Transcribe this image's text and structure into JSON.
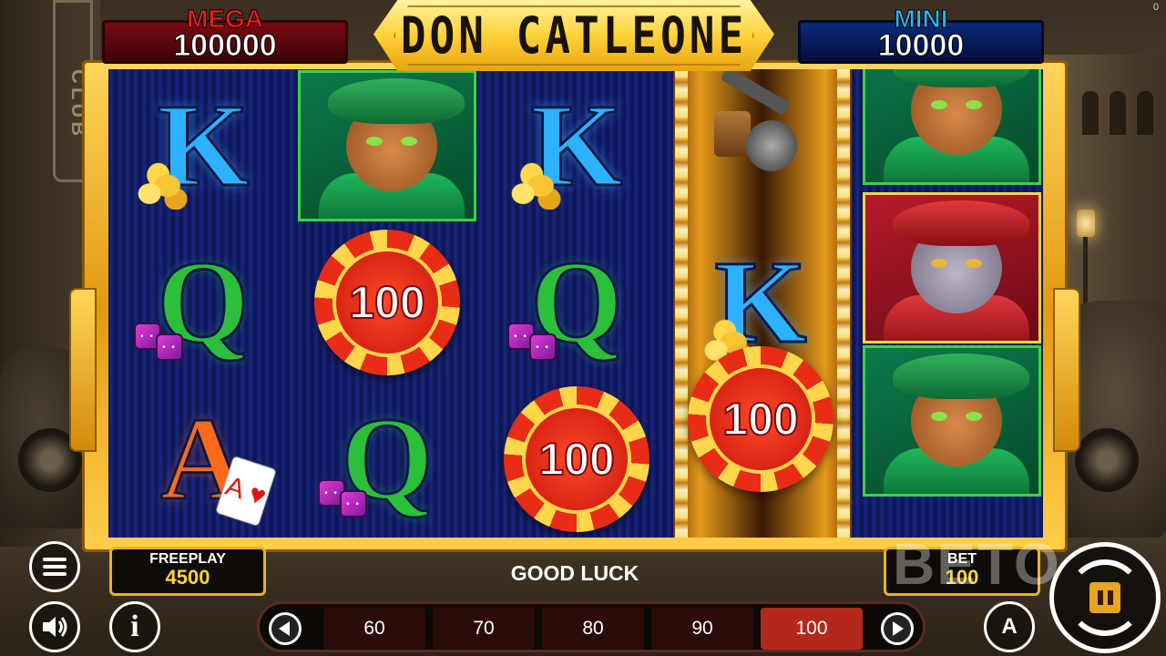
{
  "game": {
    "title": "DON CATLEONE",
    "corner_counter": "0"
  },
  "jackpots": {
    "mega": {
      "label": "MEGA",
      "value": "100000",
      "color": "#ff1a1a"
    },
    "mini": {
      "label": "MINI",
      "value": "10000",
      "color": "#2ab6ff"
    }
  },
  "background": {
    "sign_text": "CLUB"
  },
  "reels": {
    "symbols": [
      [
        {
          "kind": "letter",
          "text": "K",
          "extra": "coins"
        },
        {
          "kind": "letter",
          "text": "Q",
          "extra": "dice"
        },
        {
          "kind": "letter",
          "text": "A",
          "extra": "card"
        }
      ],
      [
        {
          "kind": "cat-green"
        },
        {
          "kind": "chip",
          "text": "100"
        },
        {
          "kind": "letter",
          "text": "Q",
          "extra": "dice"
        }
      ],
      [
        {
          "kind": "letter",
          "text": "K",
          "extra": "coins"
        },
        {
          "kind": "letter",
          "text": "Q",
          "extra": "dice"
        },
        {
          "kind": "chip",
          "text": "100"
        }
      ],
      [
        {
          "kind": "gun"
        },
        {
          "kind": "letter",
          "text": "K",
          "extra": "coins"
        },
        {
          "kind": "chip",
          "text": "100"
        }
      ],
      [
        {
          "kind": "cat-green"
        },
        {
          "kind": "cat-red"
        },
        {
          "kind": "cat-green"
        }
      ]
    ],
    "card_symbol": "A ♥"
  },
  "freeplay": {
    "label": "FREEPLAY",
    "value": "4500"
  },
  "message": "GOOD LUCK",
  "bet": {
    "label": "BET",
    "value": "100"
  },
  "bet_options": [
    "60",
    "70",
    "80",
    "90",
    "100"
  ],
  "bet_selected_index": 4,
  "buttons": {
    "auto_label": "A",
    "info_label": "i"
  },
  "watermark": "BETO",
  "colors": {
    "accent_gold": "#e7b420",
    "active_bet": "#b4281c",
    "reel_bg": "#10195a"
  }
}
